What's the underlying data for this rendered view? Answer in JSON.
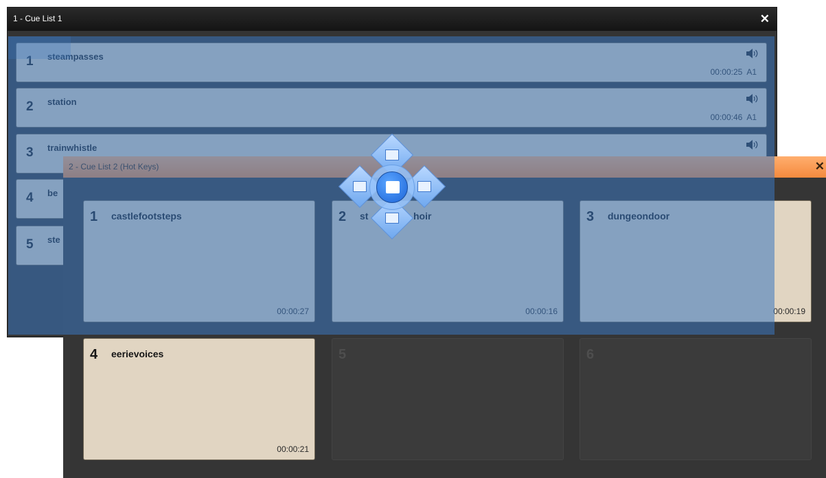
{
  "window1": {
    "title": "1 - Cue List 1",
    "close_glyph": "✕",
    "cues": [
      {
        "num": "1",
        "name": "steampasses",
        "duration": "00:00:25",
        "output": "A1",
        "icon": "speaker-icon"
      },
      {
        "num": "2",
        "name": "station",
        "duration": "00:00:46",
        "output": "A1",
        "icon": "speaker-icon"
      },
      {
        "num": "3",
        "name": "trainwhistle",
        "duration": "",
        "output": "",
        "icon": "speaker-icon"
      },
      {
        "num": "4",
        "name": "be",
        "duration": "",
        "output": "",
        "icon": ""
      },
      {
        "num": "5",
        "name": "ste",
        "duration": "",
        "output": "",
        "icon": ""
      }
    ]
  },
  "window2": {
    "title": "2 - Cue List 2 (Hot Keys)",
    "close_glyph": "✕",
    "hotkeys": [
      {
        "num": "1",
        "name": "castlefootsteps",
        "duration": "00:00:27"
      },
      {
        "num": "2",
        "name": "st",
        "name_tail": "hoir",
        "duration": "00:00:16"
      },
      {
        "num": "3",
        "name": "dungeondoor",
        "duration": "00:00:19"
      },
      {
        "num": "4",
        "name": "eerievoices",
        "duration": "00:00:21"
      },
      {
        "num": "5",
        "name": "",
        "duration": ""
      },
      {
        "num": "6",
        "name": "",
        "duration": ""
      }
    ]
  },
  "dock_guide": {
    "icons": [
      "dock-top-icon",
      "dock-left-icon",
      "dock-center-icon",
      "dock-right-icon",
      "dock-bottom-icon"
    ]
  },
  "colors": {
    "cue_fill": "#e1d5c2",
    "window2_title": "#f58a3e",
    "dock_overlay": "#3a76c0"
  }
}
